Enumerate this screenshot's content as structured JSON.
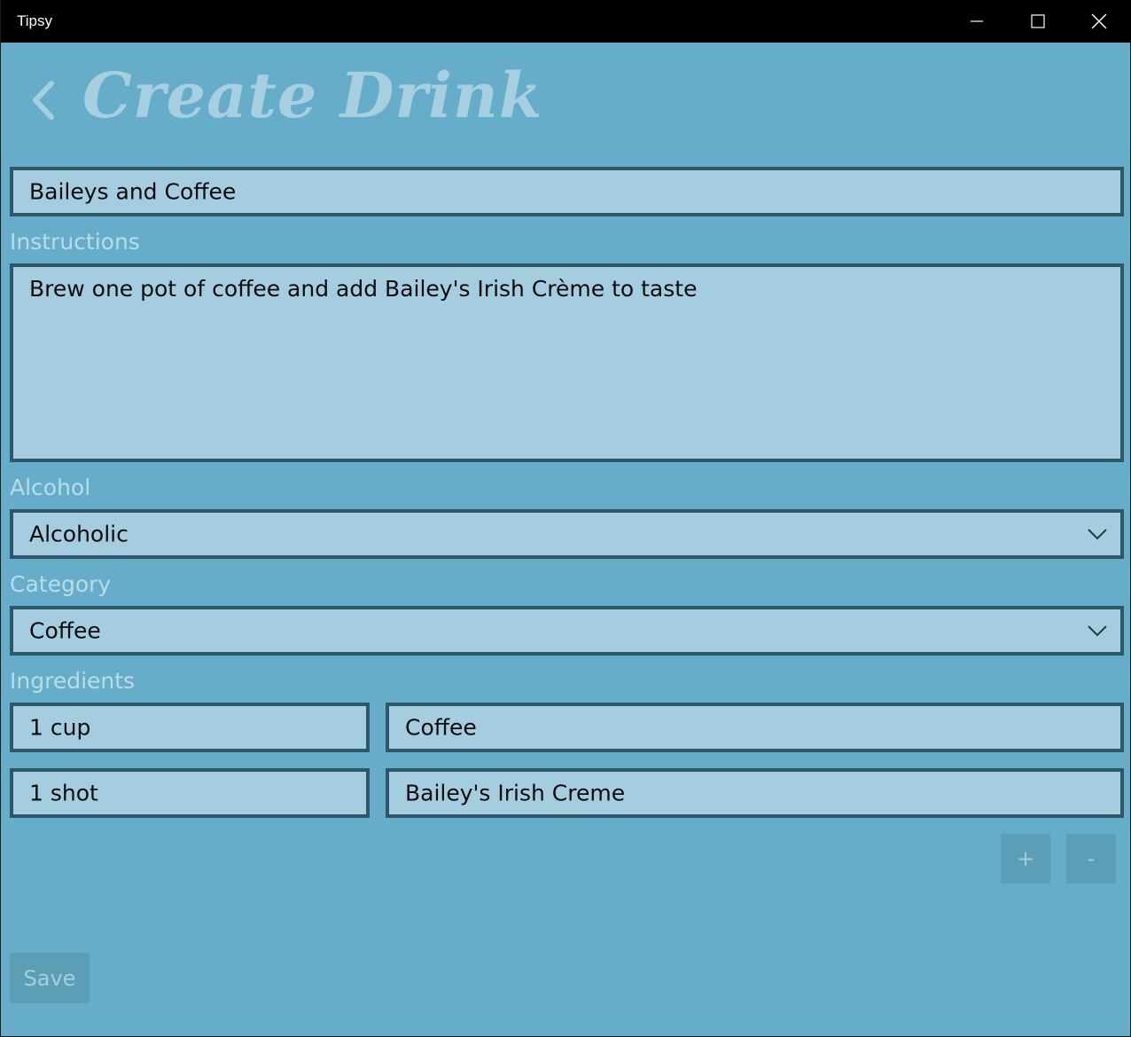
{
  "window": {
    "title": "Tipsy",
    "controls": {
      "minimize": "minimize-icon",
      "maximize": "maximize-icon",
      "close": "close-icon"
    }
  },
  "header": {
    "back_icon": "chevron-left-icon",
    "title": "Create Drink"
  },
  "form": {
    "name_value": "Baileys and Coffee",
    "instructions_label": "Instructions",
    "instructions_value": "Brew one pot of coffee and add Bailey's Irish Crème to taste",
    "alcohol_label": "Alcohol",
    "alcohol_value": "Alcoholic",
    "category_label": "Category",
    "category_value": "Coffee",
    "ingredients_label": "Ingredients",
    "ingredients": [
      {
        "amount": "1 cup",
        "name": "Coffee"
      },
      {
        "amount": "1 shot",
        "name": "Bailey's Irish Creme"
      }
    ],
    "add_label": "+",
    "remove_label": "-",
    "save_label": "Save"
  },
  "colors": {
    "background": "#66adc9",
    "field_fill": "#a4cde0",
    "field_border": "#2e5868",
    "label": "#b8dcea",
    "button": "#5d9eb7"
  }
}
